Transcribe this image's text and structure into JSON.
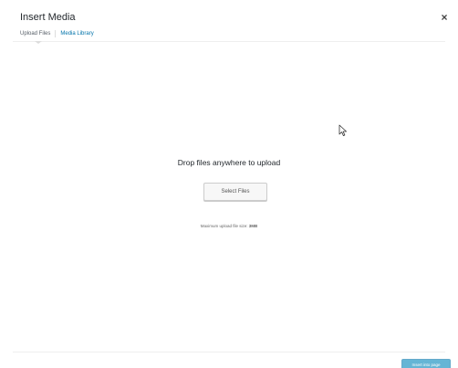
{
  "modal": {
    "title": "Insert Media",
    "close_symbol": "×"
  },
  "tabs": [
    {
      "label": "Upload Files",
      "active": true
    },
    {
      "label": "Media Library",
      "active": false
    }
  ],
  "uploader": {
    "drop_instructions": "Drop files anywhere to upload",
    "select_button_label": "Select Files",
    "max_size_label": "Maximum upload file size:",
    "max_size_value": "3MB"
  },
  "toolbar": {
    "insert_button_label": "Insert into page"
  },
  "colors": {
    "link": "#0073aa",
    "primary_button": "#0085ba"
  },
  "icons": {
    "close": "close-icon",
    "cursor": "mouse-pointer-icon"
  }
}
